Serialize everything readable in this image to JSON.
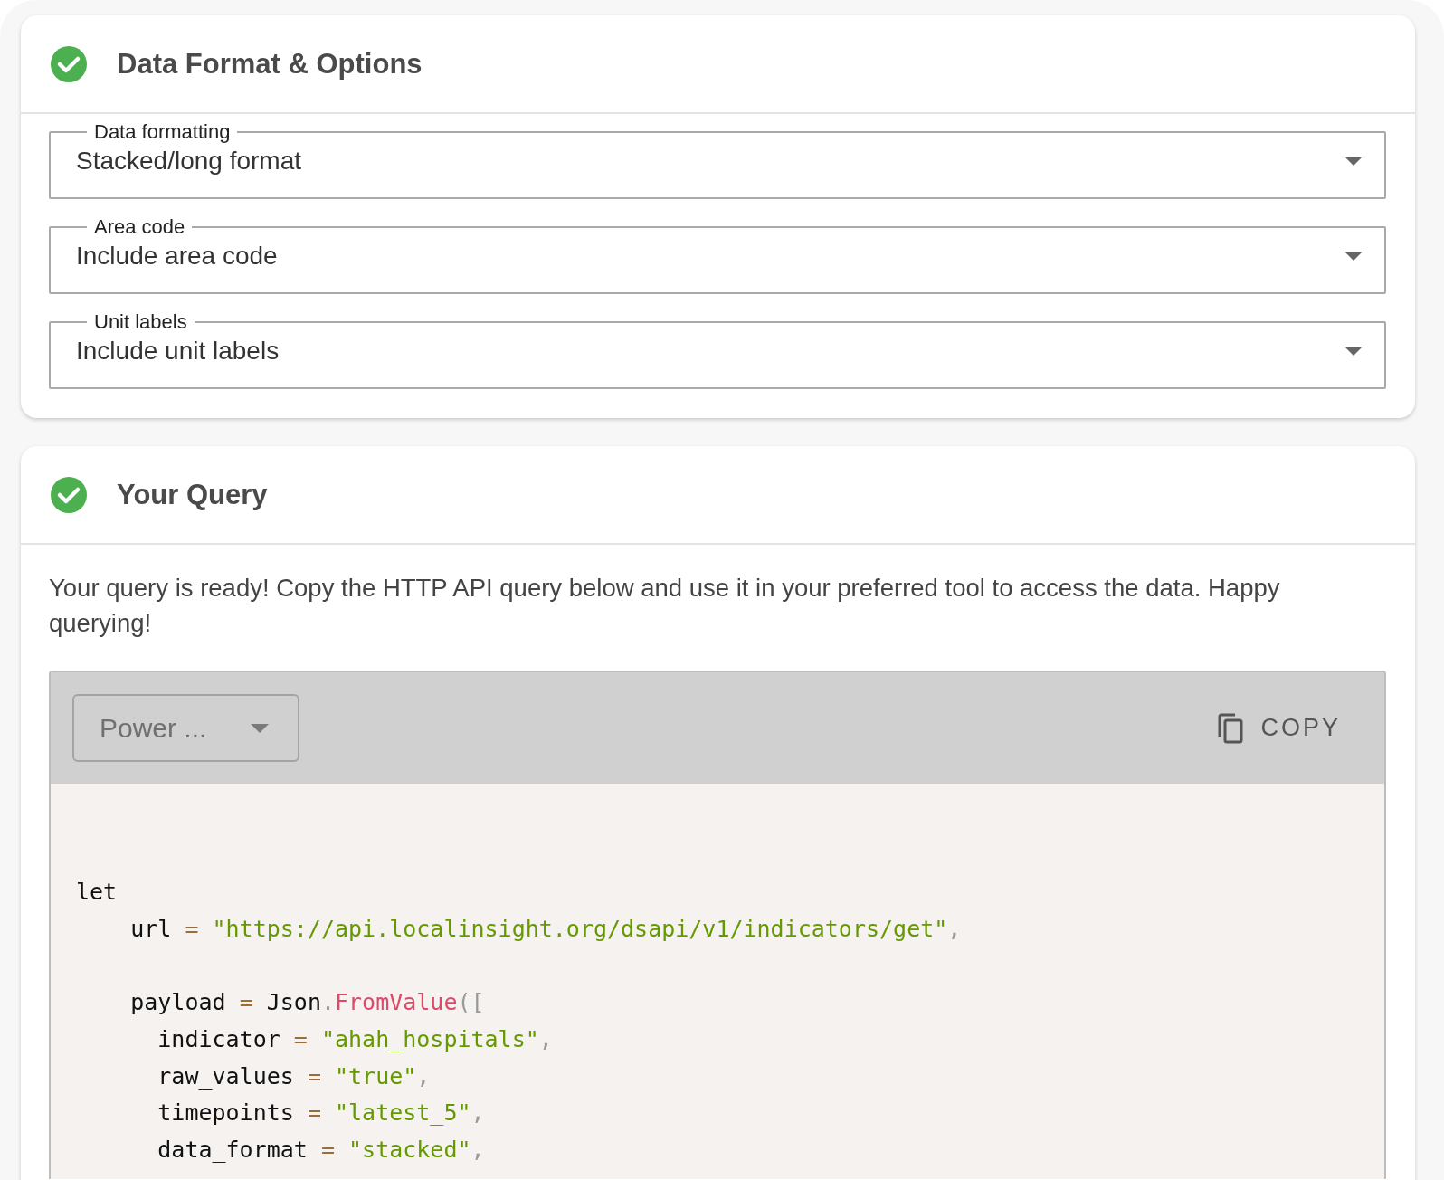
{
  "format_card": {
    "title": "Data Format & Options",
    "complete": true,
    "fields": [
      {
        "label": "Data formatting",
        "value": "Stacked/long format"
      },
      {
        "label": "Area code",
        "value": "Include area code"
      },
      {
        "label": "Unit labels",
        "value": "Include unit labels"
      }
    ]
  },
  "query_card": {
    "title": "Your Query",
    "complete": true,
    "intro": "Your query is ready! Copy the HTTP API query below and use it in your preferred tool to access the data. Happy querying!",
    "language_select": {
      "value": "Power ...",
      "disabled": true
    },
    "copy_button": "COPY",
    "code_lines": [
      {
        "kind": "code",
        "tokens": [
          {
            "kind": "plain",
            "text": "let"
          }
        ]
      },
      {
        "kind": "code",
        "tokens": [
          {
            "kind": "plain",
            "text": "    url"
          },
          {
            "kind": "op",
            "text": " = "
          },
          {
            "kind": "string",
            "text": "\"https://api.localinsight.org/dsapi/v1/indicators/get\""
          },
          {
            "kind": "punct",
            "text": ","
          }
        ]
      },
      {
        "kind": "blank"
      },
      {
        "kind": "code",
        "tokens": [
          {
            "kind": "plain",
            "text": "    payload"
          },
          {
            "kind": "op",
            "text": " = "
          },
          {
            "kind": "plain",
            "text": "Json"
          },
          {
            "kind": "punct",
            "text": "."
          },
          {
            "kind": "func",
            "text": "FromValue"
          },
          {
            "kind": "punct",
            "text": "(["
          }
        ]
      },
      {
        "kind": "code",
        "tokens": [
          {
            "kind": "plain",
            "text": "      indicator"
          },
          {
            "kind": "op",
            "text": " = "
          },
          {
            "kind": "string",
            "text": "\"ahah_hospitals\""
          },
          {
            "kind": "punct",
            "text": ","
          }
        ]
      },
      {
        "kind": "code",
        "tokens": [
          {
            "kind": "plain",
            "text": "      raw_values"
          },
          {
            "kind": "op",
            "text": " = "
          },
          {
            "kind": "string",
            "text": "\"true\""
          },
          {
            "kind": "punct",
            "text": ","
          }
        ]
      },
      {
        "kind": "code",
        "tokens": [
          {
            "kind": "plain",
            "text": "      timepoints"
          },
          {
            "kind": "op",
            "text": " = "
          },
          {
            "kind": "string",
            "text": "\"latest_5\""
          },
          {
            "kind": "punct",
            "text": ","
          }
        ]
      },
      {
        "kind": "code",
        "tokens": [
          {
            "kind": "plain",
            "text": "      data_format"
          },
          {
            "kind": "op",
            "text": " = "
          },
          {
            "kind": "string",
            "text": "\"stacked\""
          },
          {
            "kind": "punct",
            "text": ","
          }
        ]
      }
    ]
  }
}
